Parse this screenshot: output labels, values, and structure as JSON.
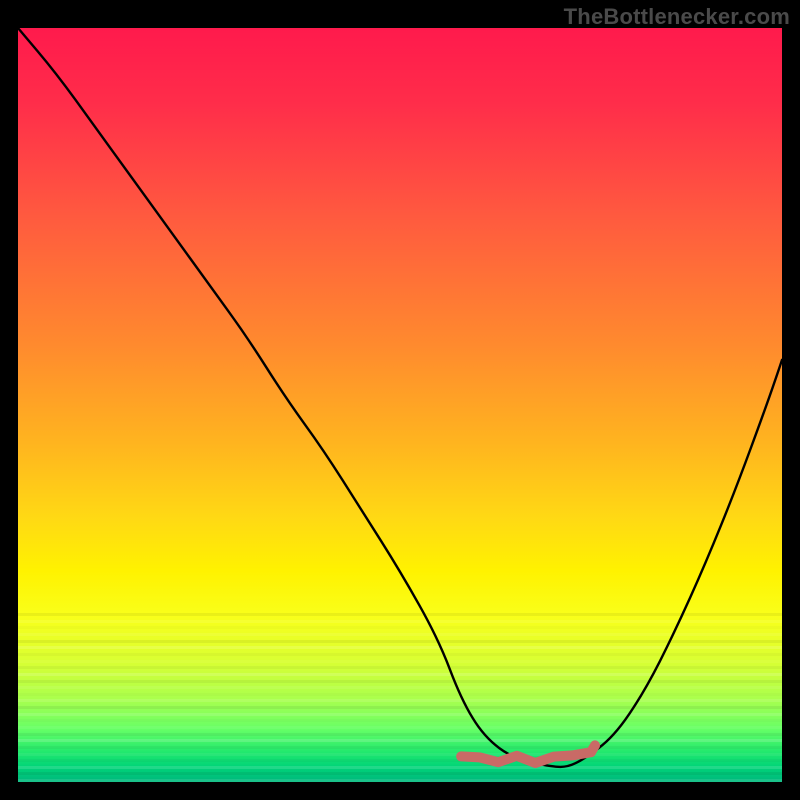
{
  "watermark": "TheBottlenecker.com",
  "colors": {
    "line": "#000000",
    "marker": "#c96a66",
    "background": "#000000"
  },
  "chart_data": {
    "type": "line",
    "title": "",
    "xlabel": "",
    "ylabel": "",
    "xlim": [
      0,
      100
    ],
    "ylim": [
      0,
      100
    ],
    "grid": false,
    "legend": null,
    "series": [
      {
        "name": "curve",
        "x": [
          0,
          5,
          10,
          15,
          20,
          25,
          30,
          35,
          40,
          45,
          50,
          55,
          58,
          61,
          65,
          70,
          72,
          74,
          78,
          82,
          86,
          90,
          94,
          98,
          100
        ],
        "y": [
          100,
          94,
          87,
          80,
          73,
          66,
          59,
          51,
          44,
          36,
          28,
          19,
          11,
          6,
          3,
          2,
          2,
          3,
          6,
          12,
          20,
          29,
          39,
          50,
          56
        ]
      }
    ],
    "flat_marker_region": {
      "x_start": 58,
      "x_end": 75,
      "y_approx": 3
    },
    "gradient": {
      "orientation": "vertical",
      "stops": [
        {
          "pos": 0.0,
          "color": "#ff1a4c"
        },
        {
          "pos": 0.25,
          "color": "#ff5a3f"
        },
        {
          "pos": 0.55,
          "color": "#ffb41f"
        },
        {
          "pos": 0.72,
          "color": "#fff200"
        },
        {
          "pos": 0.89,
          "color": "#aaff4d"
        },
        {
          "pos": 1.0,
          "color": "#00b87d"
        }
      ]
    }
  }
}
